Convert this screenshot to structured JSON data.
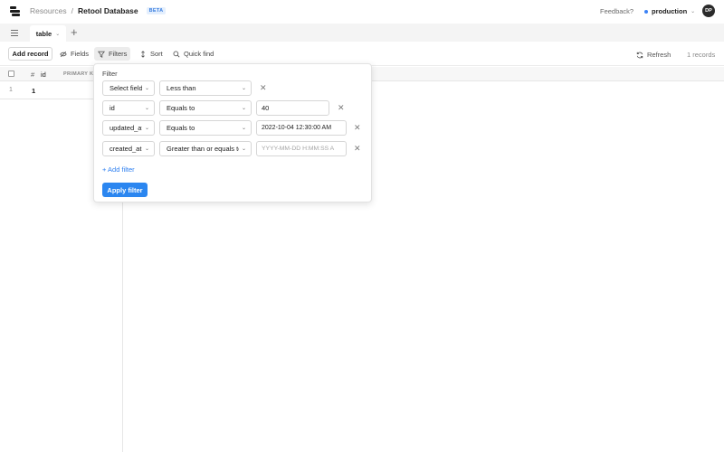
{
  "header": {
    "breadcrumb_root": "Resources",
    "breadcrumb_sep": "/",
    "title": "Retool Database",
    "badge": "BETA",
    "feedback": "Feedback?",
    "environment": "production",
    "avatar_initials": "DP",
    "env_dot_color": "#3b82f6"
  },
  "tabs": {
    "active_tab": "table",
    "add_tab": "+"
  },
  "toolbar": {
    "add_record": "Add record",
    "fields": "Fields",
    "filters": "Filters",
    "sort": "Sort",
    "quick_find": "Quick find",
    "refresh": "Refresh",
    "records_count": "1 records"
  },
  "grid": {
    "hash": "#",
    "column": "id",
    "primary_key": "PRIMARY K",
    "rows": [
      {
        "num": "1",
        "id": "1"
      }
    ]
  },
  "filter": {
    "title": "Filter",
    "rows": [
      {
        "field": "Select field",
        "operator": "Less than",
        "value": "",
        "placeholder": ""
      },
      {
        "field": "id",
        "operator": "Equals to",
        "value": "40",
        "placeholder": ""
      },
      {
        "field": "updated_at",
        "operator": "Equals to",
        "value": "2022-10-04   12:30:00 AM",
        "placeholder": ""
      },
      {
        "field": "created_at",
        "operator": "Greater than or equals to",
        "value": "",
        "placeholder": "YYYY-MM-DD   H:MM:SS A"
      }
    ],
    "add_filter": "+ Add filter",
    "apply": "Apply filter",
    "accent_color": "#2b86f0"
  }
}
